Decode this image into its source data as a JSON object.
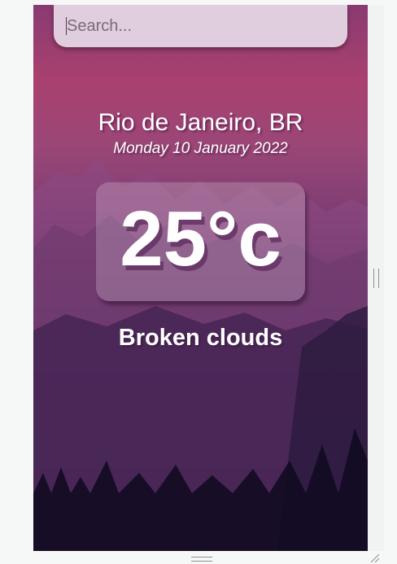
{
  "search": {
    "placeholder": "Search..."
  },
  "location": "Rio de Janeiro, BR",
  "date": "Monday 10 January 2022",
  "temperature": "25°c",
  "weather": "Broken clouds",
  "colors": {
    "accent": "#a9416f",
    "search_bg": "#e0cddd",
    "text": "#ffffff"
  }
}
